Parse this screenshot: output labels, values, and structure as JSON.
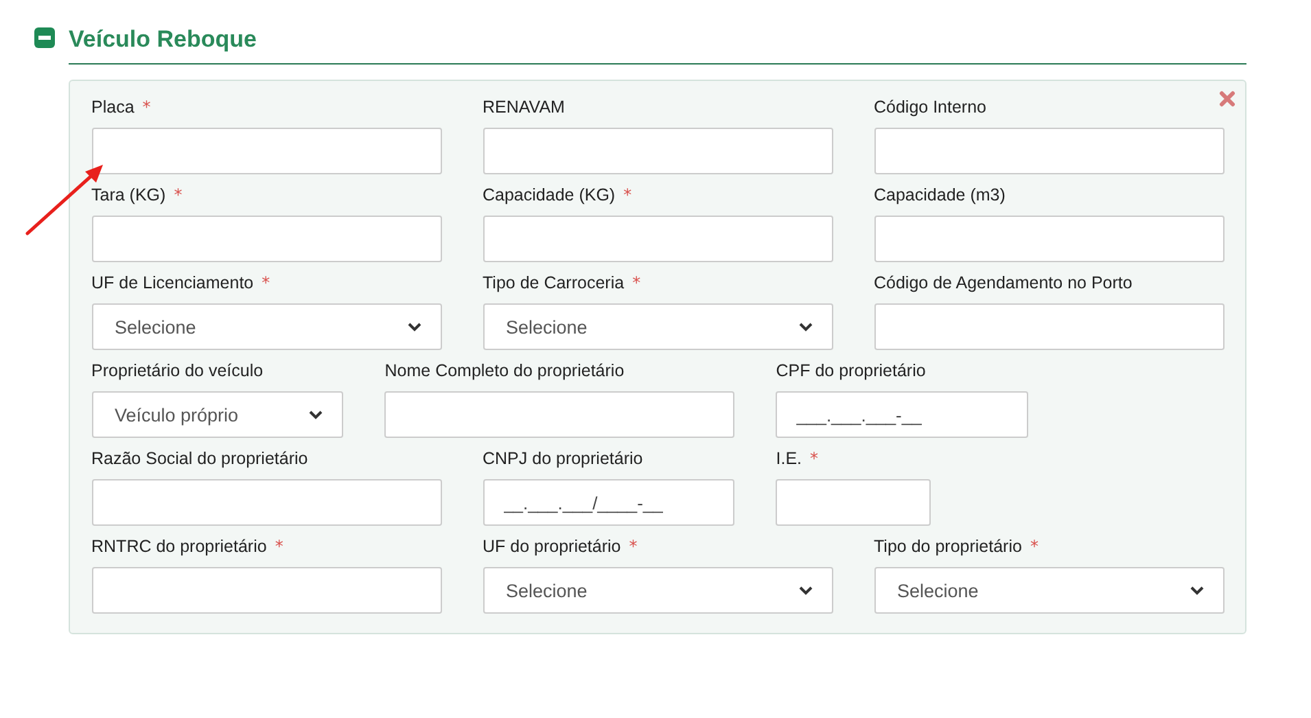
{
  "section": {
    "title": "Veículo Reboque",
    "expanded": true
  },
  "rows": [
    [
      {
        "label": "Placa",
        "asterisk": "*",
        "kind": "text"
      },
      {
        "label": "RENAVAM",
        "kind": "text"
      },
      {
        "label": "Código Interno",
        "kind": "text"
      }
    ],
    [
      {
        "label": "Tara (KG)",
        "asterisk": "*",
        "kind": "text"
      },
      {
        "label": "Capacidade (KG)",
        "asterisk": "*",
        "kind": "text"
      },
      {
        "label": "Capacidade (m3)",
        "kind": "text"
      }
    ],
    [
      {
        "label": "UF de Licenciamento",
        "asterisk": "*",
        "kind": "select",
        "value": "Selecione"
      },
      {
        "label": "Tipo de Carroceria",
        "asterisk": "*",
        "kind": "select",
        "value": "Selecione"
      },
      {
        "label": "Código de Agendamento no Porto",
        "kind": "text"
      }
    ],
    [
      {
        "label": "Proprietário do veículo",
        "kind": "select",
        "value": "Veículo próprio"
      },
      {
        "label": "Nome Completo do proprietário",
        "kind": "text"
      },
      {
        "label": "CPF do proprietário",
        "kind": "text",
        "placeholder": "___.___.___-__"
      }
    ],
    [
      {
        "label": "Razão Social do proprietário",
        "kind": "text"
      },
      {
        "label": "CNPJ do proprietário",
        "kind": "text",
        "placeholder": "__.___.___/____-__"
      },
      {
        "label": "I.E.",
        "asterisk": "*",
        "kind": "text"
      }
    ],
    [
      {
        "label": "RNTRC do proprietário",
        "asterisk": "*",
        "kind": "text"
      },
      {
        "label": "UF do proprietário",
        "asterisk": "*",
        "kind": "select",
        "value": "Selecione"
      },
      {
        "label": "Tipo do proprietário",
        "asterisk": "*",
        "kind": "select",
        "value": "Selecione"
      }
    ]
  ]
}
